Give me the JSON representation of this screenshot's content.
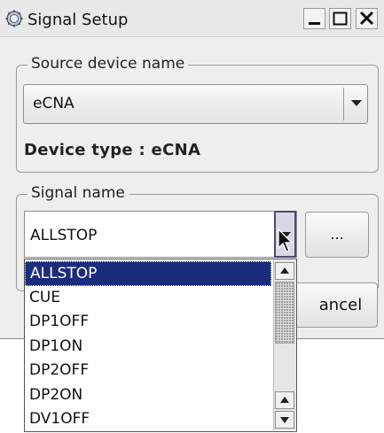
{
  "window": {
    "title": "Signal Setup",
    "icon": "gear-icon"
  },
  "source_group": {
    "legend": "Source device name",
    "selected": "eCNA",
    "device_type": "Device type : eCNA"
  },
  "signal_group": {
    "legend": "Signal name",
    "selected": "ALLSTOP",
    "browse_label": "...",
    "options": [
      "ALLSTOP",
      "CUE",
      "DP1OFF",
      "DP1ON",
      "DP2OFF",
      "DP2ON",
      "DV1OFF"
    ]
  },
  "buttons": {
    "cancel_visible": "ancel"
  },
  "colors": {
    "selection": "#1c2c7c",
    "window_bg": "#eeeeee"
  }
}
